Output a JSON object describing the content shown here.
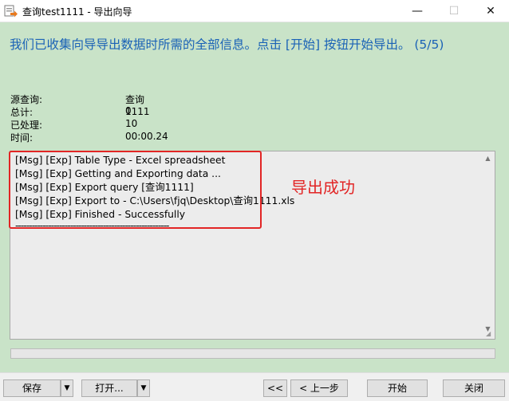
{
  "window": {
    "title": "查询test1111 - 导出向导",
    "controls": {
      "minimize": "—",
      "maximize": "☐",
      "close": "✕"
    }
  },
  "headline": "我们已收集向导导出数据时所需的全部信息。点击 [开始] 按钮开始导出。 (5/5)",
  "stats": [
    {
      "label": "源查询:",
      "value": "查询1111"
    },
    {
      "label": "总计:",
      "value": "0"
    },
    {
      "label": "已处理:",
      "value": "10"
    },
    {
      "label": "时间:",
      "value": "00:00.24"
    }
  ],
  "log": {
    "lines": [
      "[Msg] [Exp] Table Type - Excel spreadsheet",
      "[Msg] [Exp] Getting and Exporting data ...",
      "[Msg] [Exp] Export query [查询1111]",
      "[Msg] [Exp] Export to - C:\\Users\\fjq\\Desktop\\查询1111.xls",
      "[Msg] [Exp] Finished - Successfully"
    ],
    "separator": "--------------------------------------------------------"
  },
  "annotation": "导出成功",
  "progress": {
    "fraction": 0.0
  },
  "footer": {
    "save": "保存",
    "open": "打开...",
    "first": "<<",
    "back": "< 上一步",
    "start": "开始",
    "close": "关闭",
    "dropdown_glyph": "▼"
  },
  "colors": {
    "background": "#c9e3c8",
    "headline": "#1a62b6",
    "annotation_red": "#e22525"
  }
}
